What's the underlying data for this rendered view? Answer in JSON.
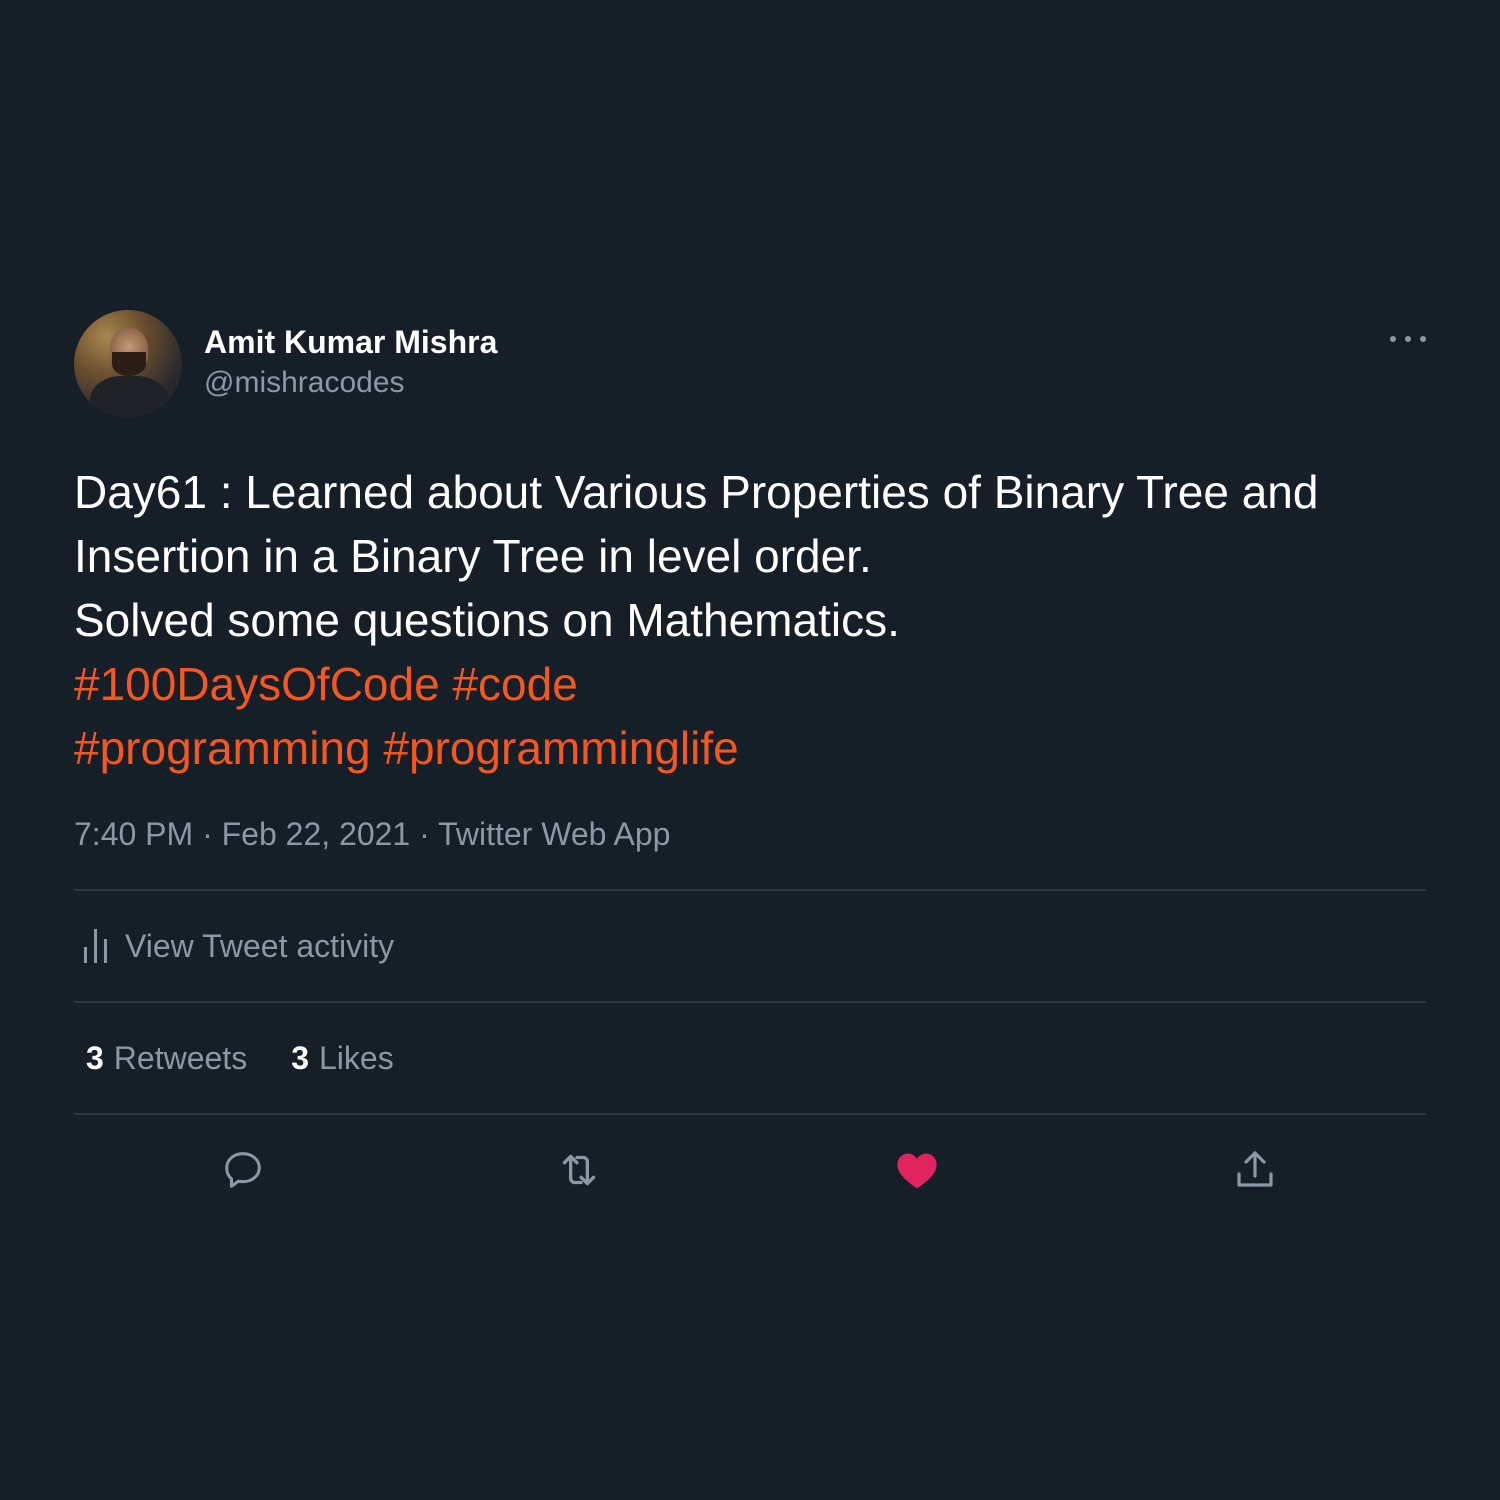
{
  "author": {
    "name": "Amit Kumar Mishra",
    "handle": "@mishracodes"
  },
  "tweet": {
    "lines": [
      "Day61 : Learned about Various Properties of Binary Tree and",
      "Insertion in a Binary Tree in level order.",
      "Solved some questions on Mathematics."
    ],
    "hashtags_line1": [
      "#100DaysOfCode",
      "#code"
    ],
    "hashtags_line2": [
      "#programming",
      "#programminglife"
    ]
  },
  "meta": {
    "time": "7:40 PM",
    "date": "Feb 22, 2021",
    "source": "Twitter Web App",
    "separator": "·"
  },
  "activity": {
    "label": "View Tweet activity",
    "icon": "bar-chart-icon"
  },
  "stats": {
    "retweets_count": "3",
    "retweets_label": "Retweets",
    "likes_count": "3",
    "likes_label": "Likes"
  },
  "actions": {
    "icons": [
      "reply-icon",
      "retweet-icon",
      "like-icon",
      "share-icon"
    ],
    "like_color": "#e0245e"
  },
  "colors": {
    "background": "#161e28",
    "hashtag": "#f4581e",
    "secondary_text": "#8b98a5"
  }
}
